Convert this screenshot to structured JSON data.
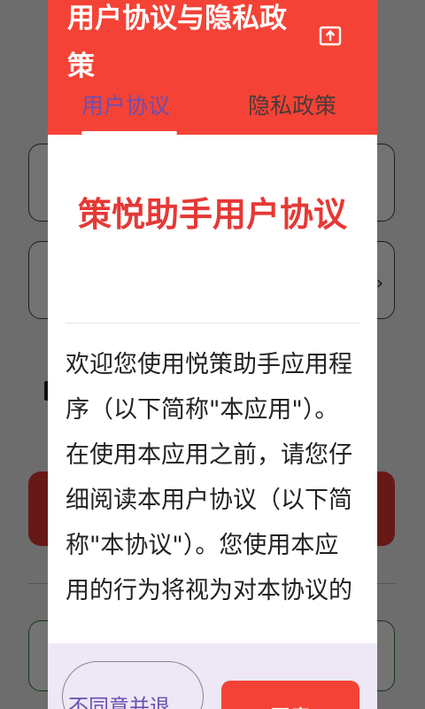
{
  "dialog": {
    "header_title": "用户协议与隐私政策",
    "tabs": [
      {
        "label": "用户协议",
        "selected": true
      },
      {
        "label": "隐私政策",
        "selected": false
      }
    ],
    "doc_title": "策悦助手用户协议",
    "doc_body": "欢迎您使用悦策助手应用程序（以下简称\"本应用\"）。在使用本应用之前，请您仔细阅读本用户协议（以下简称\"本协议\"）。您使用本应用的行为将视为对本协议的",
    "decline_label": "不同意并退",
    "agree_label": "同意"
  },
  "colors": {
    "header": "#f44336",
    "accent": "#6a4fb0",
    "title": "#e53935",
    "footer": "#ede7f6"
  },
  "icons": {
    "share": "share-icon",
    "chevron": "chevron-right-icon"
  }
}
